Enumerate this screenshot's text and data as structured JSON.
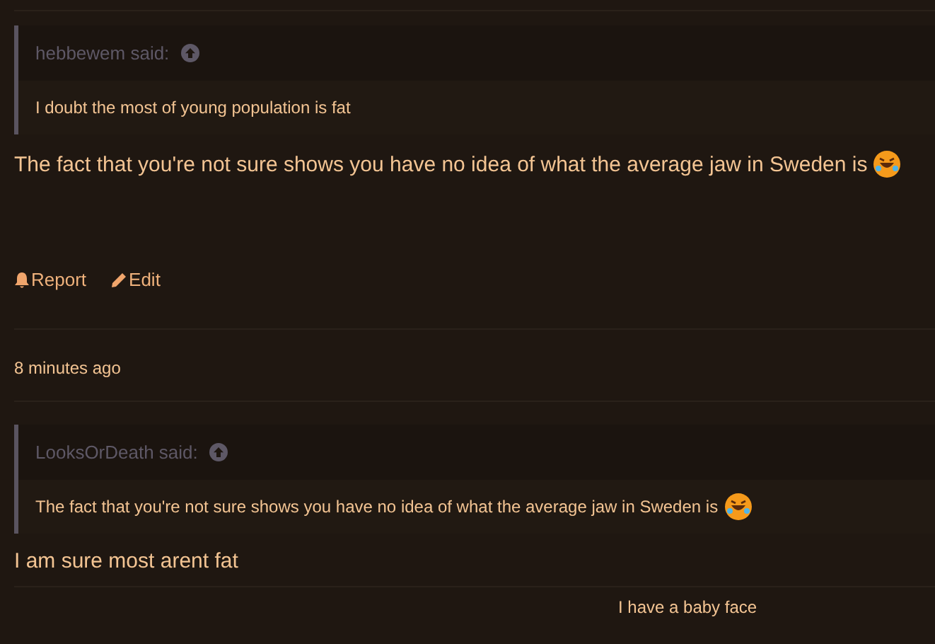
{
  "posts": [
    {
      "quote": {
        "header": "hebbewem said:",
        "text": "I doubt the most of young population is fat",
        "emoji": false
      },
      "body": "The fact that you're not sure shows you have no idea of what the average jaw in Sweden is",
      "body_emoji": true,
      "actions": [
        {
          "kind": "report",
          "label": "Report"
        },
        {
          "kind": "edit",
          "label": "Edit"
        }
      ]
    },
    {
      "time": "8 minutes ago",
      "quote": {
        "header": "LooksOrDeath said:",
        "text": "The fact that you're not sure shows you have no idea of what the average jaw in Sweden is",
        "emoji": true
      },
      "body": "I am sure most arent fat",
      "body_emoji": false,
      "signature": "I have a baby face"
    }
  ]
}
